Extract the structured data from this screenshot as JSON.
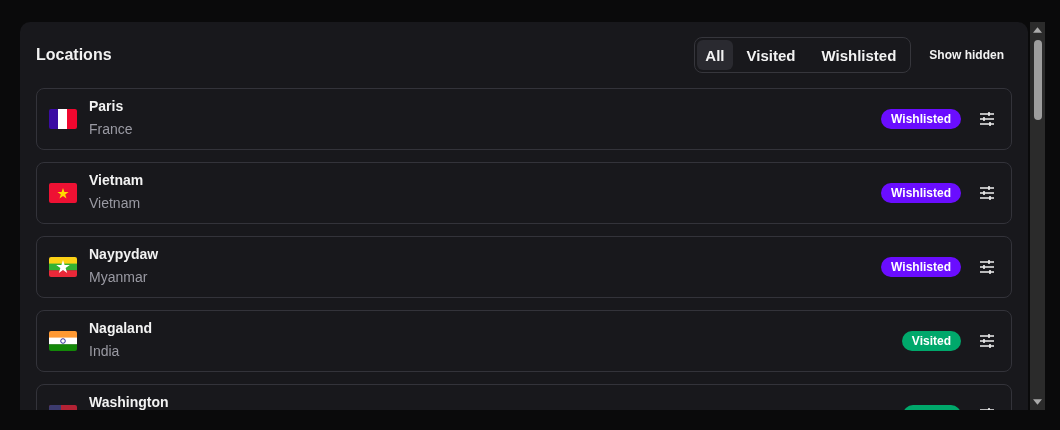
{
  "title": "Locations",
  "filters": [
    {
      "label": "All",
      "selected": true
    },
    {
      "label": "Visited",
      "selected": false
    },
    {
      "label": "Wishlisted",
      "selected": false
    }
  ],
  "show_hidden": "Show hidden",
  "locations": [
    {
      "name": "Paris",
      "country": "France",
      "flag": {
        "kind": "france"
      },
      "kind": "wishlisted",
      "badge": "Wishlisted"
    },
    {
      "name": "Vietnam",
      "country": "Vietnam",
      "flag": {
        "kind": "vietnam"
      },
      "kind": "wishlisted",
      "badge": "Wishlisted"
    },
    {
      "name": "Naypydaw",
      "country": "Myanmar",
      "flag": {
        "kind": "myanmar"
      },
      "kind": "wishlisted",
      "badge": "Wishlisted"
    },
    {
      "name": "Nagaland",
      "country": "India",
      "flag": {
        "kind": "india"
      },
      "kind": "visited",
      "badge": "Visited"
    },
    {
      "name": "Washington",
      "flag": {
        "kind": "usa"
      },
      "kind": "visited"
    }
  ]
}
